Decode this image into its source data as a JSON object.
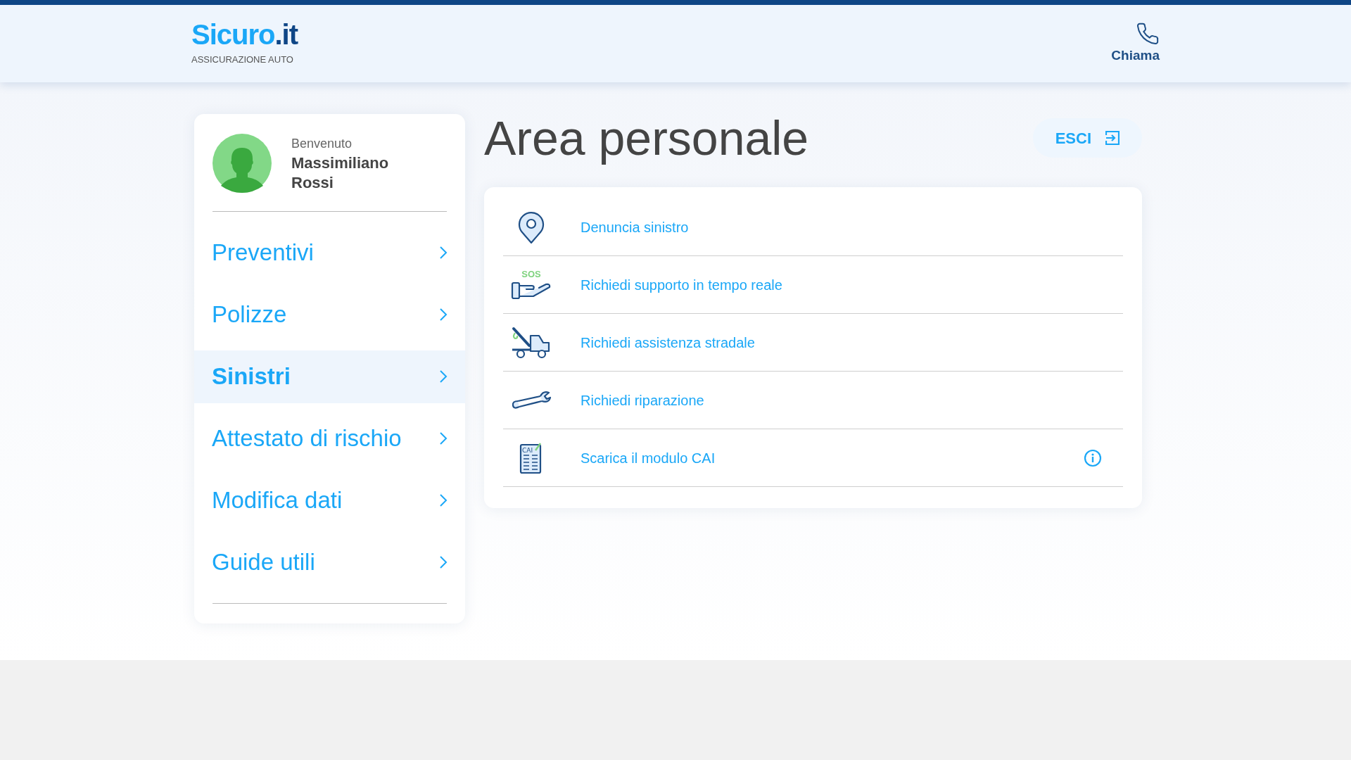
{
  "header": {
    "logo": {
      "name": "Sicuro",
      "suffix": ".it"
    },
    "tagline": "ASSICURAZIONE AUTO",
    "call_label": "Chiama"
  },
  "profile": {
    "greeting": "Benvenuto",
    "name": "Massimiliano Rossi"
  },
  "sidebar": {
    "items": [
      {
        "label": "Preventivi",
        "selected": false
      },
      {
        "label": "Polizze",
        "selected": false
      },
      {
        "label": "Sinistri",
        "selected": true
      },
      {
        "label": "Attestato di rischio",
        "selected": false
      },
      {
        "label": "Modifica dati",
        "selected": false
      },
      {
        "label": "Guide utili",
        "selected": false
      }
    ]
  },
  "page": {
    "title": "Area personale",
    "logout_label": "ESCI"
  },
  "actions": [
    {
      "kind": "pin",
      "label": "Denuncia sinistro",
      "info": false
    },
    {
      "kind": "sos",
      "icon_text": "SOS",
      "label": "Richiedi supporto in tempo reale",
      "info": false
    },
    {
      "kind": "tow",
      "label": "Richiedi assistenza stradale",
      "info": false
    },
    {
      "kind": "wrench",
      "label": "Richiedi riparazione",
      "info": false
    },
    {
      "kind": "form",
      "icon_text": "CAI",
      "label": "Scarica il modulo CAI",
      "info": true
    }
  ]
}
